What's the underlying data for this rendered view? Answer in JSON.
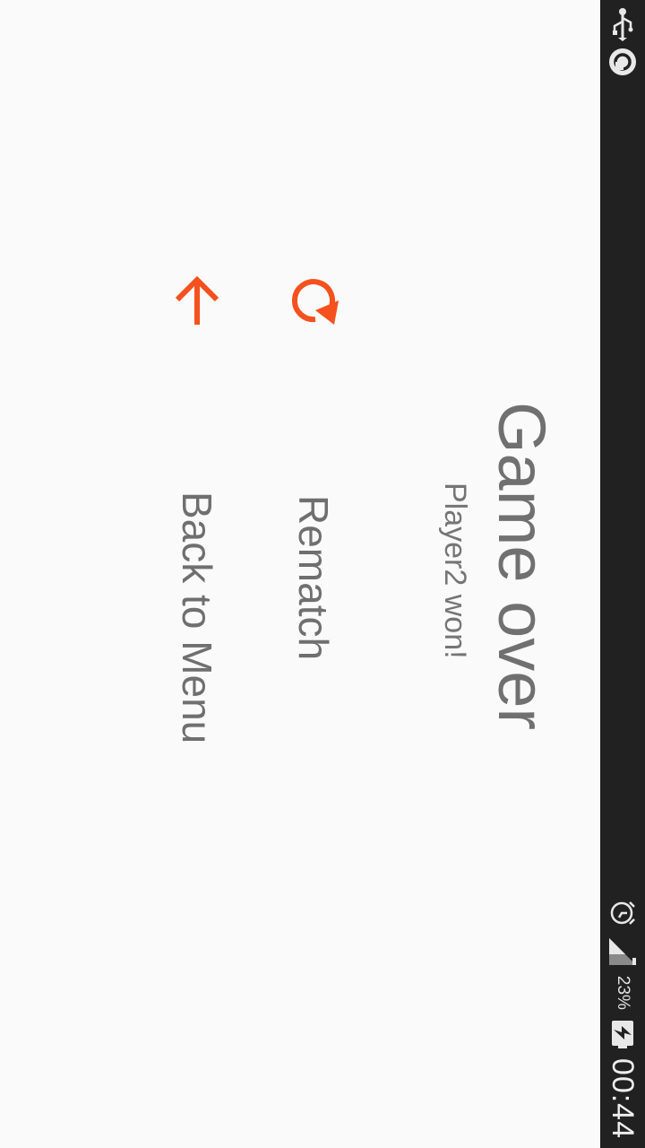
{
  "status_bar": {
    "time": "00:44",
    "battery_percent": "23%",
    "icons": [
      "usb-icon",
      "sync-icon",
      "alarm-icon",
      "signal-icon",
      "battery-charging-icon"
    ]
  },
  "game_over": {
    "title": "Game over",
    "result": "Player2 won!"
  },
  "menu": {
    "rematch_label": "Rematch",
    "back_label": "Back to Menu"
  },
  "colors": {
    "accent": "#f4511e",
    "text": "#707070",
    "background": "#fafafa",
    "status_bar": "#212121"
  }
}
